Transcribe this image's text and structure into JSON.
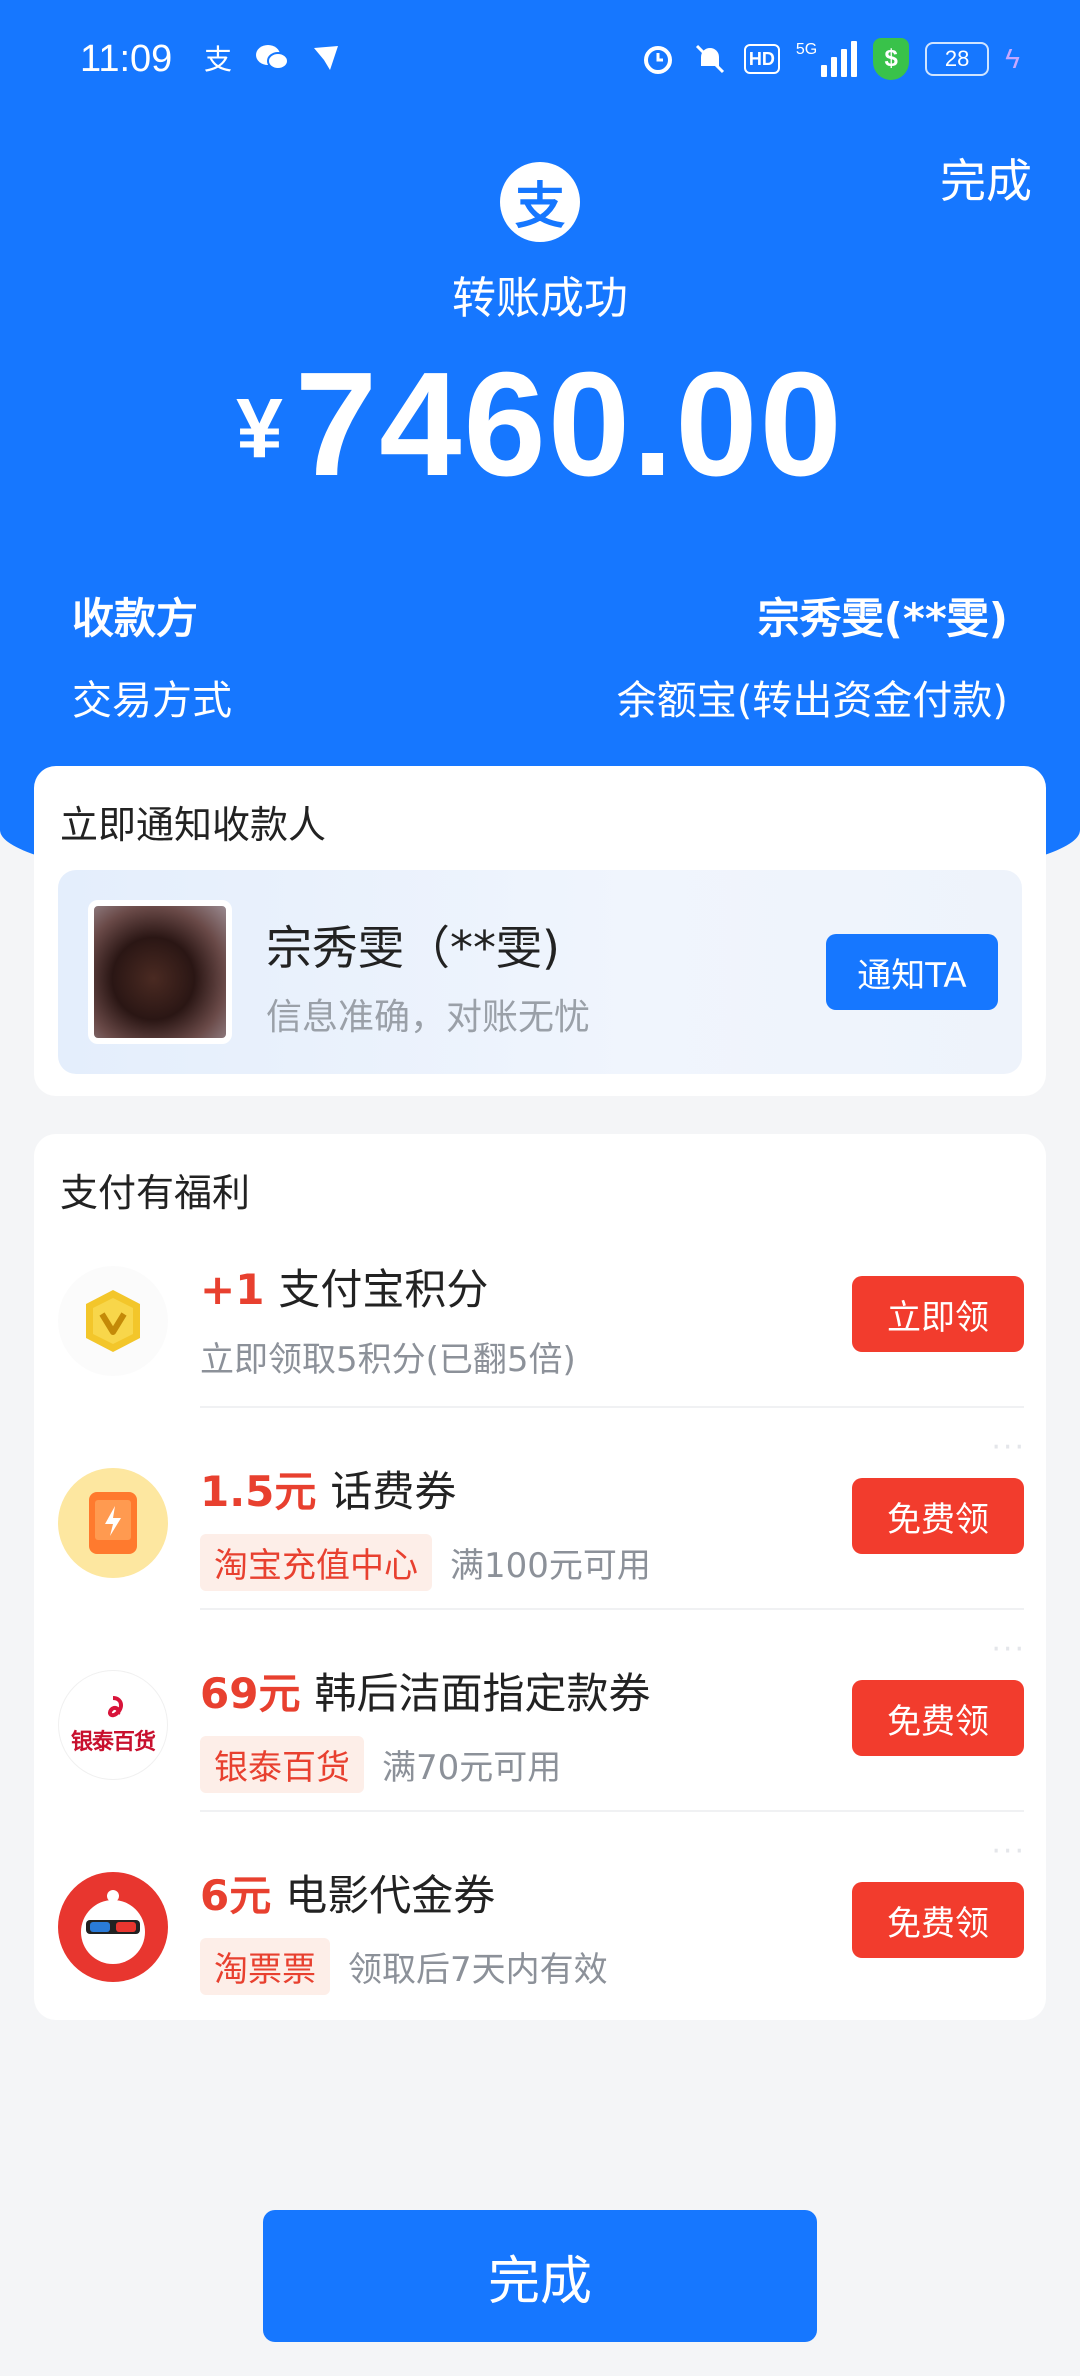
{
  "status_bar": {
    "time": "11:09",
    "left_icons": [
      "alipay-icon",
      "wechat-icon",
      "bird-icon"
    ],
    "right_icons": [
      "alarm-icon",
      "mute-icon",
      "hd-icon",
      "5g-signal-icon",
      "security-shield-icon",
      "battery-icon",
      "charging-icon"
    ],
    "hd_label": "HD",
    "net_label": "5G",
    "shield_label": "$",
    "battery_level": "28"
  },
  "header": {
    "done_label": "完成",
    "logo_char": "支",
    "title": "转账成功",
    "currency": "¥",
    "amount": "7460.00"
  },
  "details": {
    "payee_label": "收款方",
    "payee_value": "宗秀雯(**雯)",
    "method_label": "交易方式",
    "method_value": "余额宝(转出资金付款)"
  },
  "notify_card": {
    "title": "立即通知收款人",
    "name": "宗秀雯（**雯)",
    "subtitle": "信息准确，对账无忧",
    "button": "通知TA"
  },
  "benefits": {
    "title": "支付有福利",
    "items": [
      {
        "highlight": "+1",
        "title": "支付宝积分",
        "tag": "",
        "sub": "立即领取5积分(已翻5倍)",
        "button": "立即领",
        "icon": "points-coin-icon"
      },
      {
        "highlight": "1.5元",
        "title": "话费券",
        "tag": "淘宝充值中心",
        "sub": "满100元可用",
        "button": "免费领",
        "icon": "phone-charge-icon"
      },
      {
        "highlight": "69元",
        "title": "韩后洁面指定款券",
        "tag": "银泰百货",
        "sub": "满70元可用",
        "button": "免费领",
        "icon": "intime-store-logo-icon",
        "logo_text": "银泰百货"
      },
      {
        "highlight": "6元",
        "title": "电影代金券",
        "tag": "淘票票",
        "sub": "领取后7天内有效",
        "button": "免费领",
        "icon": "taopiaopiao-logo-icon"
      }
    ]
  },
  "footer": {
    "done_label": "完成"
  },
  "colors": {
    "brand_blue": "#1677ff",
    "accent_red": "#f23c2d",
    "highlight_red": "#e8402f"
  }
}
